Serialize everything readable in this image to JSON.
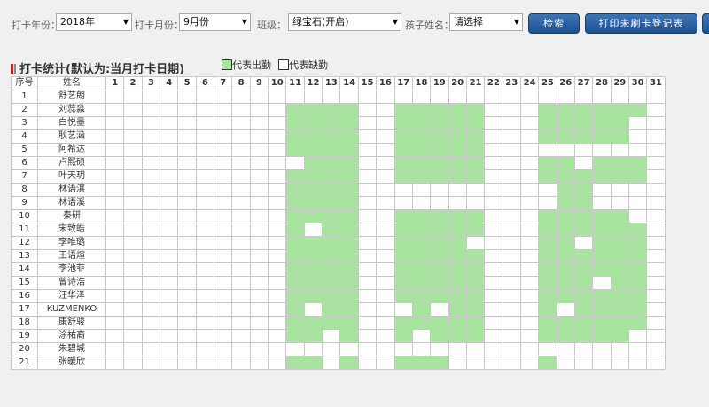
{
  "filters": {
    "year_label": "打卡年份：",
    "year_value": "2018年",
    "month_label": "打卡月份：",
    "month_value": "9月份",
    "class_label": "班级：",
    "class_value": "绿宝石(开启)",
    "child_label": "孩子姓名：",
    "child_value": "请选择"
  },
  "buttons": {
    "search": "检索",
    "print": "打印未刷卡登记表"
  },
  "section": {
    "title": "打卡统计(默认为:当月打卡日期)",
    "legend_present": "代表出勤",
    "legend_absent": "代表缺勤"
  },
  "colors": {
    "present": "#a8e4a0",
    "absent": "#ffffff",
    "button": "#2a5f9e"
  },
  "table": {
    "col_index": "序号",
    "col_name": "姓名",
    "days": [
      1,
      2,
      3,
      4,
      5,
      6,
      7,
      8,
      9,
      10,
      11,
      12,
      13,
      14,
      15,
      16,
      17,
      18,
      19,
      20,
      21,
      22,
      23,
      24,
      25,
      26,
      27,
      28,
      29,
      30,
      31
    ],
    "rows": [
      {
        "no": "1",
        "name": "舒艺朗",
        "present": []
      },
      {
        "no": "2",
        "name": "刘蕊淼",
        "present": [
          11,
          12,
          13,
          14,
          17,
          18,
          19,
          20,
          21,
          25,
          26,
          27,
          28,
          29,
          30
        ]
      },
      {
        "no": "3",
        "name": "白悦墨",
        "present": [
          11,
          12,
          13,
          14,
          17,
          18,
          19,
          20,
          21,
          25,
          26,
          27,
          28,
          29
        ]
      },
      {
        "no": "4",
        "name": "耿艺涵",
        "present": [
          11,
          12,
          13,
          14,
          17,
          18,
          19,
          20,
          21,
          25,
          26,
          27,
          28,
          29
        ]
      },
      {
        "no": "5",
        "name": "阿希达",
        "present": [
          11,
          12,
          13,
          14,
          17,
          18,
          19,
          20,
          21
        ]
      },
      {
        "no": "6",
        "name": "卢熙硕",
        "present": [
          12,
          13,
          14,
          17,
          18,
          19,
          20,
          21,
          25,
          26,
          28,
          29,
          30
        ]
      },
      {
        "no": "7",
        "name": "叶天玥",
        "present": [
          11,
          12,
          13,
          14,
          17,
          18,
          19,
          20,
          21,
          25,
          26,
          27,
          28,
          29,
          30
        ]
      },
      {
        "no": "8",
        "name": "林语淇",
        "present": [
          11,
          12,
          13,
          14,
          26,
          27
        ]
      },
      {
        "no": "9",
        "name": "林语溪",
        "present": [
          11,
          12,
          13,
          14,
          26,
          27
        ]
      },
      {
        "no": "10",
        "name": "秦研",
        "present": [
          11,
          12,
          13,
          14,
          17,
          18,
          19,
          20,
          21,
          25,
          26,
          27,
          28,
          29
        ]
      },
      {
        "no": "11",
        "name": "宋致皓",
        "present": [
          11,
          13,
          14,
          17,
          18,
          19,
          20,
          21,
          25,
          26,
          27,
          28,
          29,
          30
        ]
      },
      {
        "no": "12",
        "name": "李唯璐",
        "present": [
          11,
          12,
          13,
          14,
          17,
          18,
          19,
          20,
          25,
          26,
          28,
          29,
          30
        ]
      },
      {
        "no": "13",
        "name": "王语煊",
        "present": [
          11,
          12,
          13,
          14,
          17,
          18,
          19,
          20,
          21,
          25,
          26,
          27,
          28,
          29,
          30
        ]
      },
      {
        "no": "14",
        "name": "李池菲",
        "present": [
          11,
          12,
          13,
          14,
          17,
          18,
          19,
          20,
          21,
          25,
          26,
          27,
          28,
          29,
          30
        ]
      },
      {
        "no": "15",
        "name": "曾诗浩",
        "present": [
          11,
          12,
          13,
          14,
          17,
          18,
          19,
          20,
          21,
          25,
          26,
          27,
          29,
          30
        ]
      },
      {
        "no": "16",
        "name": "汪华泽",
        "present": [
          11,
          12,
          13,
          14,
          17,
          18,
          19,
          20,
          21,
          25,
          26,
          27,
          28,
          29,
          30
        ]
      },
      {
        "no": "17",
        "name": "KUZMENKO",
        "present": [
          11,
          13,
          14,
          18,
          20,
          21,
          25,
          27,
          28,
          29,
          30
        ]
      },
      {
        "no": "18",
        "name": "康舒骏",
        "present": [
          11,
          12,
          13,
          14,
          17,
          18,
          19,
          20,
          21,
          25,
          26,
          27,
          28,
          29,
          30
        ]
      },
      {
        "no": "19",
        "name": "涂祐裔",
        "present": [
          11,
          12,
          14,
          17,
          19,
          20,
          21,
          25,
          26,
          27,
          28,
          29
        ]
      },
      {
        "no": "20",
        "name": "朱碧城",
        "present": []
      },
      {
        "no": "21",
        "name": "张暖欣",
        "present": [
          11,
          12,
          14,
          17,
          18,
          19,
          25
        ]
      }
    ]
  }
}
